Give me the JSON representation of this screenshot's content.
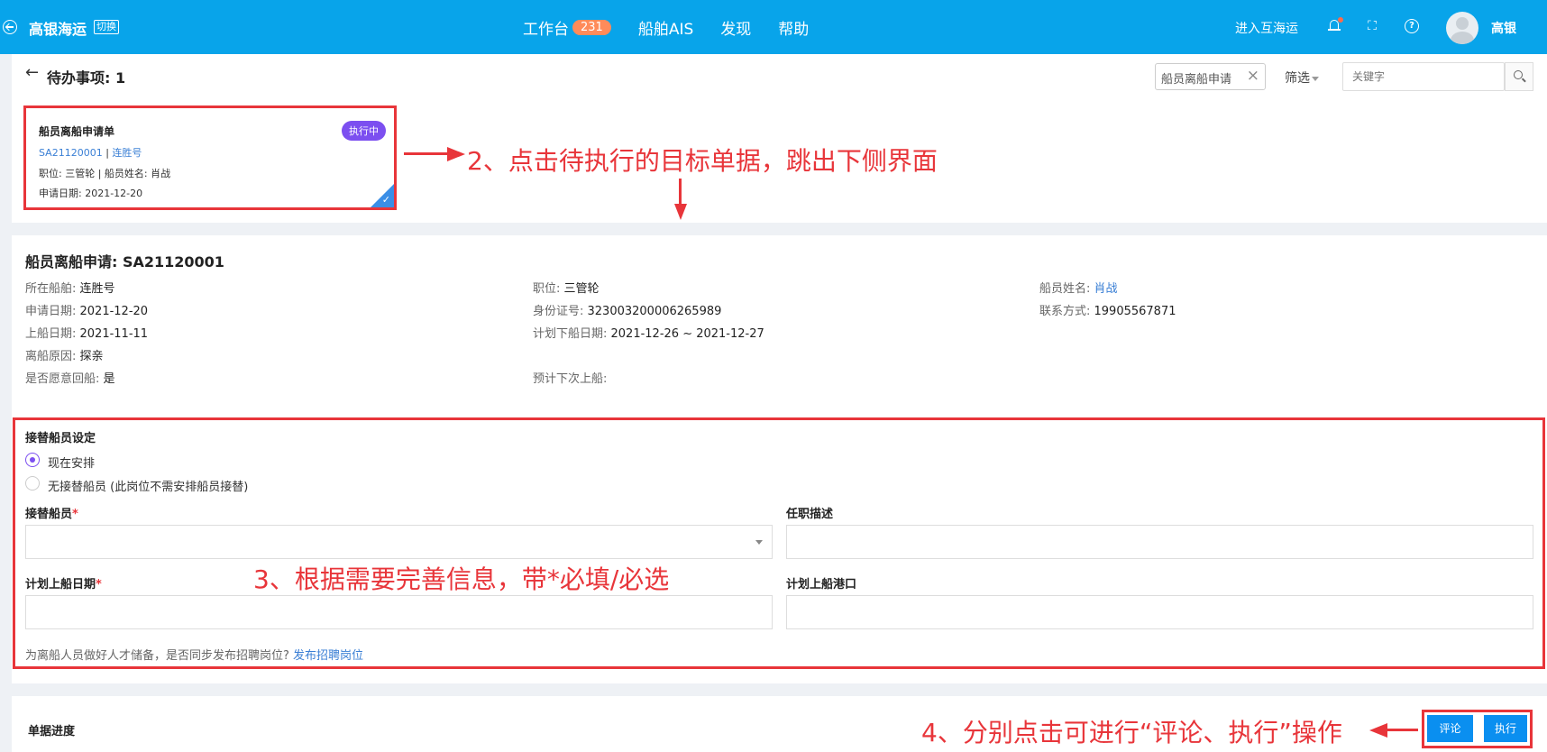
{
  "header": {
    "brand": "高银海运",
    "switch_label": "切换",
    "nav": [
      {
        "label": "工作台",
        "badge": "231"
      },
      {
        "label": "船舶AIS"
      },
      {
        "label": "发现"
      },
      {
        "label": "帮助"
      }
    ],
    "enter_link": "进入互海运",
    "username": "高银",
    "icons": [
      "back-circle-icon",
      "bell-icon",
      "expand-icon",
      "help-icon",
      "avatar"
    ],
    "accent_color": "#08a4ea"
  },
  "todo": {
    "back_arrow": "←",
    "title": "待办事项: 1"
  },
  "filters": {
    "chip": "船员离船申请",
    "filter_label": "筛选",
    "search_placeholder": "关键字"
  },
  "card": {
    "title": "船员离船申请单",
    "status": "执行中",
    "code": "SA21120001",
    "separator": "|",
    "ship": "连胜号",
    "position_line": "职位: 三管轮 | 船员姓名: 肖战",
    "date_line": "申请日期: 2021-12-20"
  },
  "annotations": {
    "step2": "2、点击待执行的目标单据，跳出下侧界面",
    "step3": "3、根据需要完善信息，带*必填/必选",
    "step4": "4、分别点击可进行“评论、执行”操作"
  },
  "detail": {
    "title": "船员离船申请: SA21120001",
    "fields": {
      "ship": {
        "label": "所在船舶: ",
        "value": "连胜号"
      },
      "apply_date": {
        "label": "申请日期: ",
        "value": "2021-12-20"
      },
      "board_date": {
        "label": "上船日期: ",
        "value": "2021-11-11"
      },
      "reason": {
        "label": "离船原因: ",
        "value": "探亲"
      },
      "return": {
        "label": "是否愿意回船: ",
        "value": "是"
      },
      "position": {
        "label": "职位: ",
        "value": "三管轮"
      },
      "id_no": {
        "label": "身份证号: ",
        "value": "323003200006265989"
      },
      "plan_leave": {
        "label": "计划下船日期: ",
        "value": "2021-12-26 ~ 2021-12-27"
      },
      "next_board": {
        "label": "预计下次上船: ",
        "value": ""
      },
      "name": {
        "label": "船员姓名: ",
        "value": "肖战"
      },
      "contact": {
        "label": "联系方式: ",
        "value": "19905567871"
      }
    }
  },
  "replacement": {
    "section_title": "接替船员设定",
    "radio_now": "现在安排",
    "radio_none": "无接替船员 (此岗位不需安排船员接替)",
    "replacement_label": "接替船员",
    "duty_label": "任职描述",
    "plan_date_label": "计划上船日期",
    "plan_port_label": "计划上船港口",
    "required_mark": "*",
    "recruit_text": "为离船人员做好人才储备，是否同步发布招聘岗位? ",
    "recruit_link": "发布招聘岗位"
  },
  "bottom": {
    "progress_title": "单据进度",
    "comment_button": "评论",
    "execute_button": "执行"
  }
}
